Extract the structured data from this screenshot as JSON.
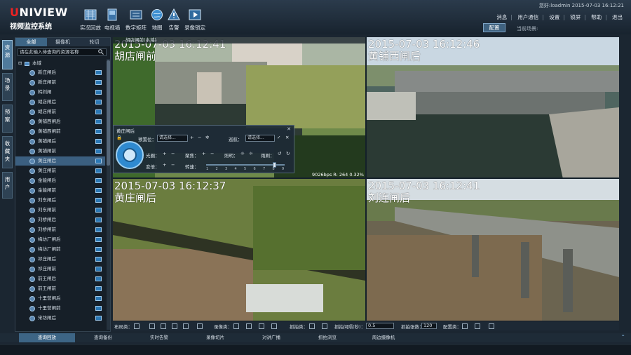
{
  "app": {
    "brand": "UNIVIEW",
    "subtitle": "视频监控系统"
  },
  "toolbar": [
    {
      "label": "实况回放",
      "icon": "live-playback-icon"
    },
    {
      "label": "电视墙",
      "icon": "tv-wall-icon"
    },
    {
      "label": "数字矩阵",
      "icon": "digital-matrix-icon"
    },
    {
      "label": "地图",
      "icon": "map-icon"
    },
    {
      "label": "告警",
      "icon": "alarm-icon"
    },
    {
      "label": "录像锁定",
      "icon": "record-lock-icon"
    }
  ],
  "header": {
    "user_time": "您好:loadmin 2015-07-03 16:12:21",
    "links": [
      "消息",
      "用户通信",
      "设置",
      "锁屏",
      "帮助",
      "退出"
    ],
    "config_button": "配置",
    "current_scene": "当前场景:"
  },
  "side_tabs": [
    "资源",
    "场景",
    "预案",
    "收藏夹",
    "用户"
  ],
  "resource": {
    "tabs": [
      "全部",
      "摄像机",
      "轮切"
    ],
    "search_placeholder": "请在此输入待查询的资源名称",
    "root": "本域",
    "items": [
      "新庄闸后",
      "新庄闸前",
      "韩刘闸",
      "胡店闸后",
      "胡店闸前",
      "黄铺西闸后",
      "黄铺西闸前",
      "黄铺闸后",
      "黄铺闸前",
      "黄庄闸后",
      "黄庄闸前",
      "金能闸后",
      "金能闸前",
      "刘东闸后",
      "刘东闸前",
      "刘桥闸后",
      "刘桥闸前",
      "梅坊厂闸后",
      "梅坊厂闸前",
      "祁庄闸后",
      "祁庄闸前",
      "前王闸后",
      "前王闸前",
      "十里营闸后",
      "十里营闸前",
      "宋坊闸后"
    ],
    "selected_index": 9
  },
  "video": {
    "top_title": "胡店闸前(本域)",
    "cells": [
      {
        "date": "2015-07-03",
        "time": "16:12:41",
        "name": "胡店闸前",
        "stats": "9026bps  R: 264   0.32%"
      },
      {
        "date": "2015-07-03",
        "time": "16:12:46",
        "name": "黄铺西闸后",
        "stats": ""
      },
      {
        "date": "2015-07-03",
        "time": "16:12:37",
        "name": "黄庄闸后",
        "stats": ""
      },
      {
        "date": "2015-07-03",
        "time": "16:12:41",
        "name": "刘连闸后",
        "stats": ""
      }
    ]
  },
  "ptz": {
    "title": "黄庄闸后",
    "preset_label": "预置位：",
    "preset_value": "请选择...",
    "cruise_label": "巡航：",
    "cruise_value": "请选择...",
    "iris_label": "光圈：",
    "focus_label": "聚焦：",
    "light_label": "照明：",
    "wiper_label": "雨刷：",
    "zoom_label": "变倍：",
    "speed_label": "转速：",
    "speed_ticks": [
      "1",
      "2",
      "3",
      "4",
      "5",
      "6",
      "7",
      "8",
      "9"
    ],
    "speed_value": 8
  },
  "bottom_bar": {
    "layout_label": "布局类：",
    "record_label": "录像类：",
    "capture_label": "抓拍类：",
    "interval_label": "抓拍间隔(秒)：",
    "interval_value": "0.5",
    "count_label": "抓拍张数：",
    "count_value": "120",
    "volume_label": "配置类："
  },
  "bottom_tabs": [
    "查询回放",
    "查询备份",
    "实时告警",
    "录像切片",
    "对讲广播",
    "抓拍浏览",
    "周边摄像机"
  ],
  "colors": {
    "accent": "#3d6585",
    "brand_red": "#e22222"
  }
}
